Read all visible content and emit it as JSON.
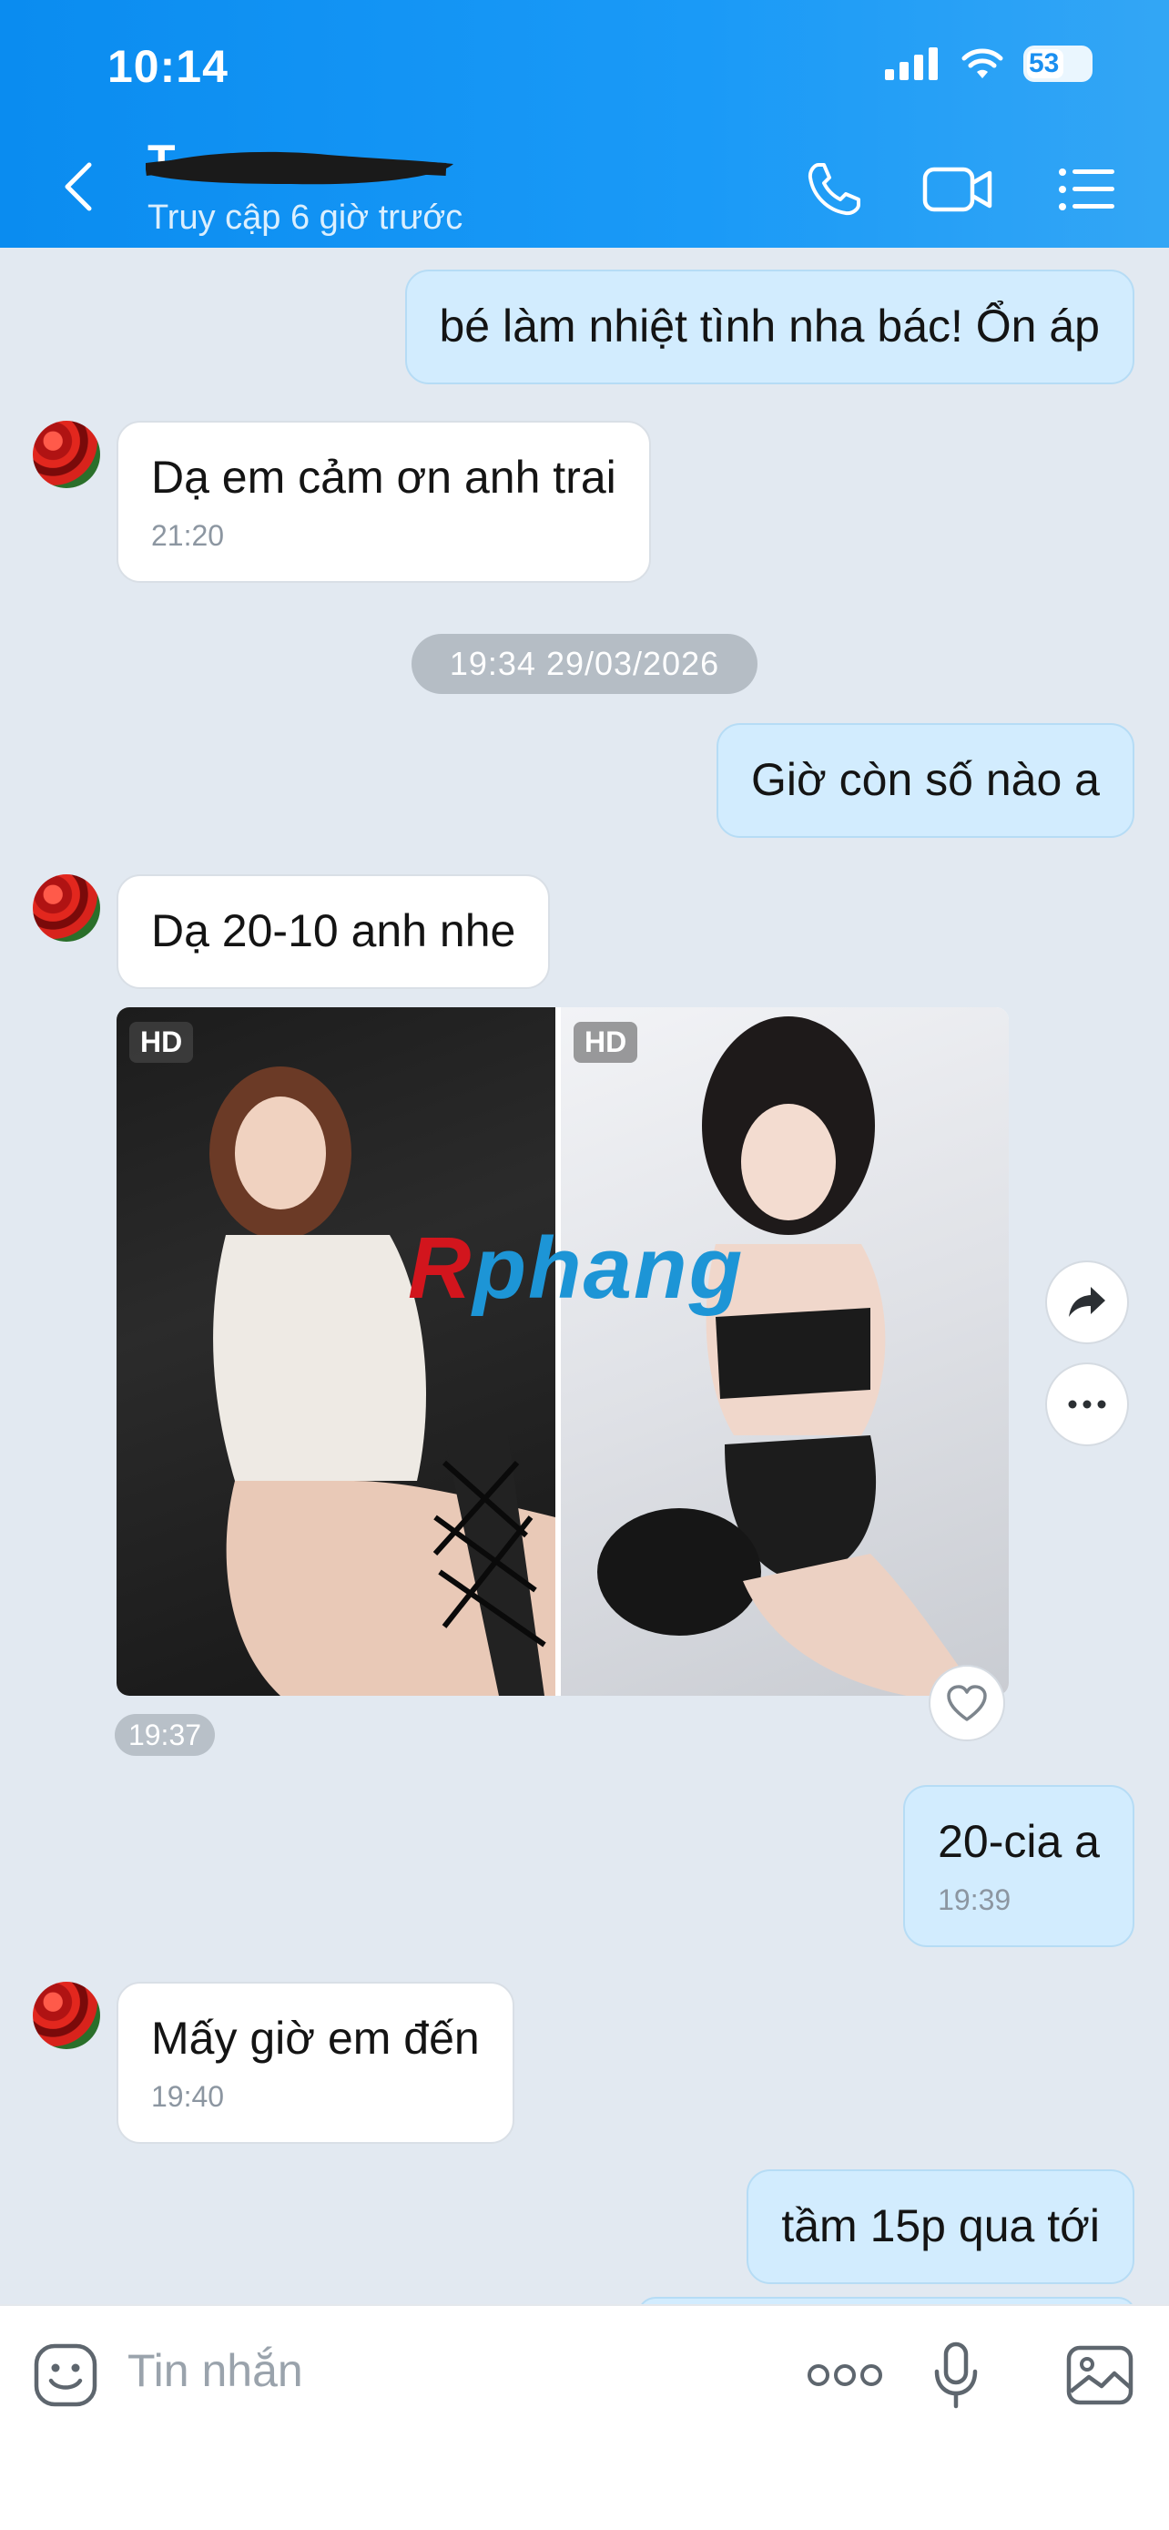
{
  "status_bar": {
    "time": "10:14",
    "battery": "53"
  },
  "header": {
    "contact_name": "T",
    "last_seen": "Truy cập 6 giờ trước"
  },
  "messages": [
    {
      "direction": "out",
      "text": "bé làm nhiệt tình nha bác! Ổn áp",
      "time": ""
    },
    {
      "direction": "in",
      "text": "Dạ em cảm ơn anh trai",
      "time": "21:20"
    },
    {
      "direction": "out",
      "text": "Giờ còn số nào a",
      "time": ""
    },
    {
      "direction": "in",
      "text": "Dạ 20-10 anh nhe",
      "time": ""
    },
    {
      "direction": "out",
      "text": "20-cia a",
      "time": "19:39"
    },
    {
      "direction": "in",
      "text": "Mấy giờ em đến",
      "time": "19:40"
    },
    {
      "direction": "out",
      "text": "tầm 15p qua tới",
      "time": ""
    }
  ],
  "date_separator": "19:34 29/03/2026",
  "media": {
    "badge_left": "HD",
    "badge_right": "HD",
    "watermark_part1": "R",
    "watermark_part2": "phang",
    "time": "19:37"
  },
  "composer": {
    "placeholder": "Tin nhắn"
  },
  "icons": {
    "back": "chevron-left-icon",
    "call": "phone-icon",
    "video": "video-camera-icon",
    "menu": "list-menu-icon",
    "share": "share-arrow-icon",
    "more": "more-horizontal-icon",
    "like": "heart-icon",
    "sticker": "sticker-smile-icon",
    "mic": "microphone-icon",
    "gallery": "image-gallery-icon"
  },
  "colors": {
    "header": "#1a9af7",
    "outgoing_bubble": "#d2ecfe",
    "incoming_bubble": "#ffffff",
    "background": "#e2e9f1"
  }
}
